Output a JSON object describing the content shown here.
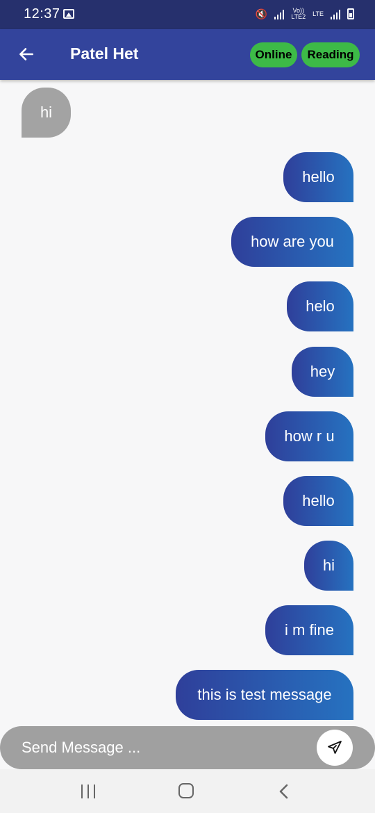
{
  "status_bar": {
    "time": "12:37",
    "network_top": "Vo))",
    "network_bottom": "LTE2",
    "lte_label": "LTE"
  },
  "header": {
    "title": "Patel Het",
    "chips": [
      "Online",
      "Reading"
    ]
  },
  "messages": [
    {
      "type": "received",
      "text": "hi"
    },
    {
      "type": "sent",
      "text": "hello"
    },
    {
      "type": "sent",
      "text": "how are you"
    },
    {
      "type": "sent",
      "text": "helo"
    },
    {
      "type": "sent",
      "text": "hey"
    },
    {
      "type": "sent",
      "text": "how r u"
    },
    {
      "type": "sent",
      "text": "hello"
    },
    {
      "type": "sent",
      "text": "hi"
    },
    {
      "type": "sent",
      "text": "i m fine"
    },
    {
      "type": "sent",
      "text": "this is test message"
    }
  ],
  "composer": {
    "placeholder": "Send Message ..."
  },
  "colors": {
    "status_bar": "#26306d",
    "app_bar": "#33449c",
    "chip": "#3dba47",
    "received_bubble": "#a3a3a3",
    "sent_gradient_start": "#2f3f9a",
    "sent_gradient_end": "#2672c0",
    "composer": "#a0a0a0"
  },
  "icons": {
    "back": "arrow-left-icon",
    "send": "send-icon",
    "nav_recents": "recents-icon",
    "nav_home": "home-icon",
    "nav_back": "chevron-left-icon"
  }
}
